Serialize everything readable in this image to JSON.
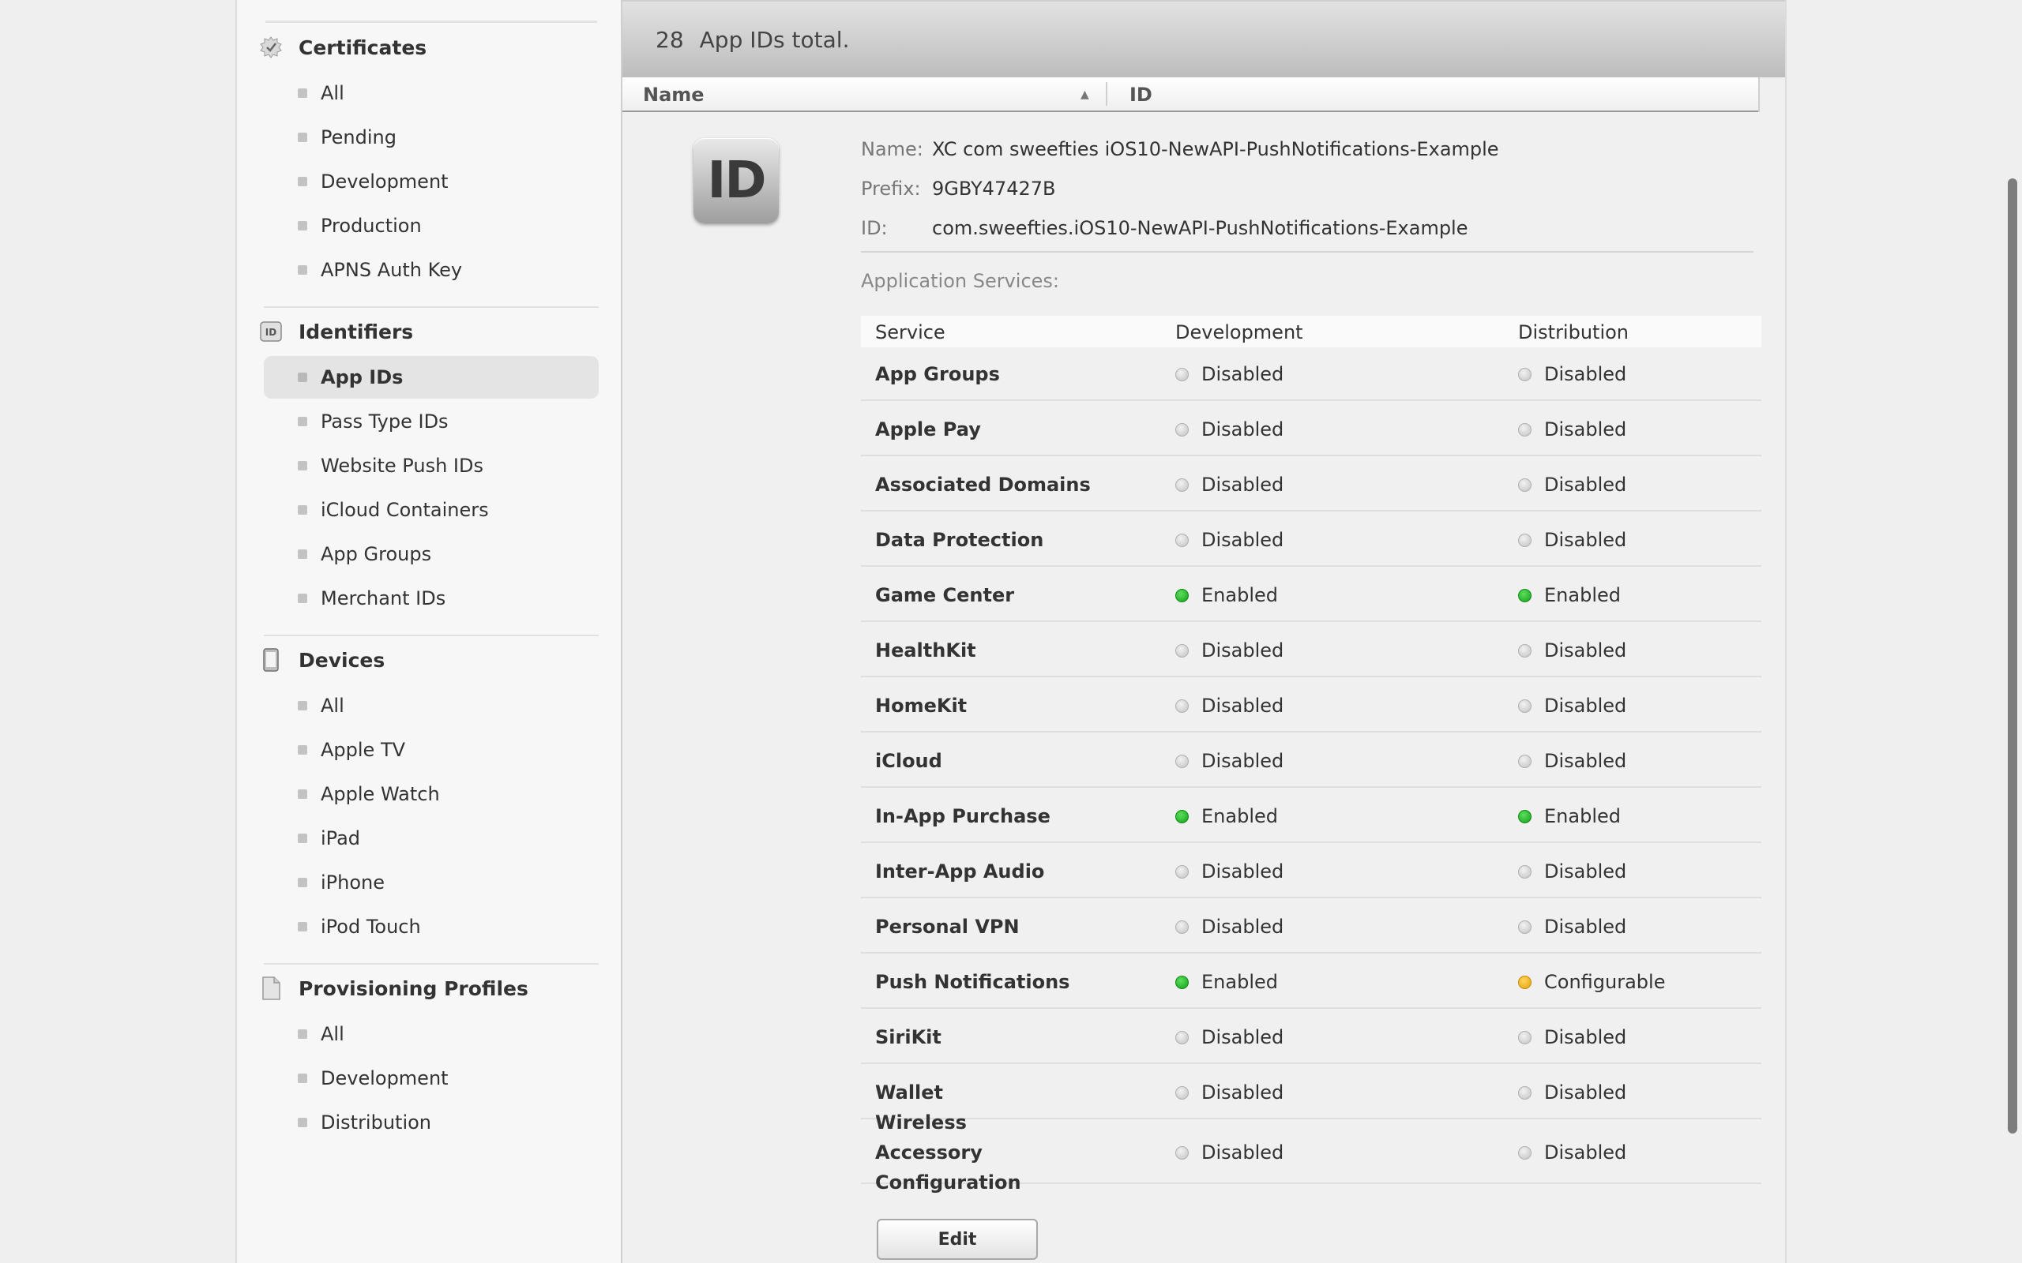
{
  "sidebar": {
    "certificates": {
      "title": "Certificates",
      "icon": "certificate-seal-icon",
      "items": [
        "All",
        "Pending",
        "Development",
        "Production",
        "APNS Auth Key"
      ]
    },
    "identifiers": {
      "title": "Identifiers",
      "icon": "id-icon",
      "icon_text": "ID",
      "items": [
        "App IDs",
        "Pass Type IDs",
        "Website Push IDs",
        "iCloud Containers",
        "App Groups",
        "Merchant IDs"
      ],
      "active": "App IDs"
    },
    "devices": {
      "title": "Devices",
      "icon": "device-icon",
      "items": [
        "All",
        "Apple TV",
        "Apple Watch",
        "iPad",
        "iPhone",
        "iPod Touch"
      ]
    },
    "profiles": {
      "title": "Provisioning Profiles",
      "icon": "document-icon",
      "items": [
        "All",
        "Development",
        "Distribution"
      ]
    }
  },
  "main": {
    "total_count": "28",
    "total_label": "App IDs total.",
    "columns": {
      "name": "Name",
      "id": "ID"
    },
    "badge": "ID",
    "detail": {
      "name_key": "Name:",
      "name_value": "XC com sweefties iOS10-NewAPI-PushNotifications-Example",
      "prefix_key": "Prefix:",
      "prefix_value": "9GBY47427B",
      "id_key": "ID:",
      "id_value": "com.sweefties.iOS10-NewAPI-PushNotifications-Example"
    },
    "services_label": "Application Services:",
    "services_header": {
      "service": "Service",
      "development": "Development",
      "distribution": "Distribution"
    },
    "services": [
      {
        "name": "App Groups",
        "dev": "Disabled",
        "dist": "Disabled"
      },
      {
        "name": "Apple Pay",
        "dev": "Disabled",
        "dist": "Disabled"
      },
      {
        "name": "Associated Domains",
        "dev": "Disabled",
        "dist": "Disabled"
      },
      {
        "name": "Data Protection",
        "dev": "Disabled",
        "dist": "Disabled"
      },
      {
        "name": "Game Center",
        "dev": "Enabled",
        "dist": "Enabled"
      },
      {
        "name": "HealthKit",
        "dev": "Disabled",
        "dist": "Disabled"
      },
      {
        "name": "HomeKit",
        "dev": "Disabled",
        "dist": "Disabled"
      },
      {
        "name": "iCloud",
        "dev": "Disabled",
        "dist": "Disabled"
      },
      {
        "name": "In-App Purchase",
        "dev": "Enabled",
        "dist": "Enabled"
      },
      {
        "name": "Inter-App Audio",
        "dev": "Disabled",
        "dist": "Disabled"
      },
      {
        "name": "Personal VPN",
        "dev": "Disabled",
        "dist": "Disabled"
      },
      {
        "name": "Push Notifications",
        "dev": "Enabled",
        "dist": "Configurable"
      },
      {
        "name": "SiriKit",
        "dev": "Disabled",
        "dist": "Disabled"
      },
      {
        "name": "Wallet",
        "dev": "Disabled",
        "dist": "Disabled"
      },
      {
        "name": "Wireless Accessory Configuration",
        "dev": "Disabled",
        "dist": "Disabled"
      }
    ],
    "edit_label": "Edit"
  },
  "colors": {
    "enabled": "#15a01a",
    "disabled": "#c2c2c2",
    "configurable": "#e5a10c"
  }
}
